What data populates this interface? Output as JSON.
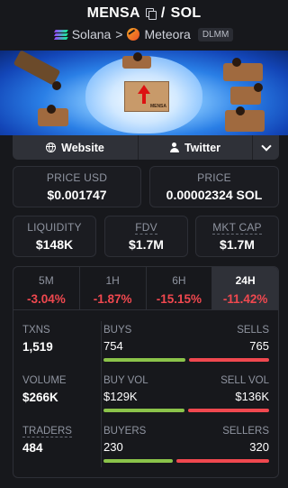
{
  "header": {
    "token": "MENSA",
    "separator": "/",
    "quote": "SOL",
    "chain": "Solana",
    "arrow": ">",
    "dex": "Meteora",
    "pool_type": "DLMM"
  },
  "links": {
    "website": "Website",
    "twitter": "Twitter"
  },
  "prices": {
    "usd_label": "PRICE USD",
    "usd_value": "$0.001747",
    "native_label": "PRICE",
    "native_value": "0.00002324 SOL"
  },
  "metrics": {
    "liquidity_label": "LIQUIDITY",
    "liquidity_value": "$148K",
    "fdv_label": "FDV",
    "fdv_value": "$1.7M",
    "mcap_label": "MKT CAP",
    "mcap_value": "$1.7M"
  },
  "timeframes": [
    {
      "label": "5M",
      "change": "-3.04%"
    },
    {
      "label": "1H",
      "change": "-1.87%"
    },
    {
      "label": "6H",
      "change": "-15.15%"
    },
    {
      "label": "24H",
      "change": "-11.42%"
    }
  ],
  "stats": {
    "txns_label": "TXNS",
    "txns_value": "1,519",
    "buys_label": "BUYS",
    "buys_value": "754",
    "sells_label": "SELLS",
    "sells_value": "765",
    "volume_label": "VOLUME",
    "volume_value": "$266K",
    "buy_vol_label": "BUY VOL",
    "buy_vol_value": "$129K",
    "sell_vol_label": "SELL VOL",
    "sell_vol_value": "$136K",
    "traders_label": "TRADERS",
    "traders_value": "484",
    "buyers_label": "BUYERS",
    "buyers_value": "230",
    "sellers_label": "SELLERS",
    "sellers_value": "320"
  },
  "ratios": {
    "buys_fraction": 0.496,
    "buy_vol_fraction": 0.487,
    "buyers_fraction": 0.418
  },
  "colors": {
    "positive": "#8bc34a",
    "negative": "#f0484f",
    "background": "#17181c"
  }
}
